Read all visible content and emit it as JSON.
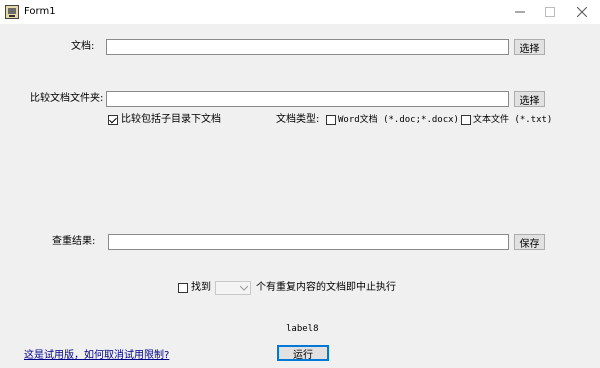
{
  "window": {
    "title": "Form1",
    "icon": "app-icon",
    "controls": [
      "minimize-icon",
      "maximize-icon",
      "close-icon"
    ]
  },
  "document": {
    "label": "文档:",
    "value": "",
    "browse_label": "选择"
  },
  "compare_folder": {
    "label": "比较文档文件夹:",
    "value": "",
    "browse_label": "选择",
    "include_subdirs": {
      "label": "比较包括子目录下文档",
      "checked": true
    }
  },
  "doc_type": {
    "label": "文档类型:",
    "word": {
      "label": "Word文档 (*.doc;*.docx)",
      "checked": false
    },
    "text": {
      "label": "文本文件 (*.txt)",
      "checked": false
    }
  },
  "result": {
    "label": "查重结果:",
    "value": "",
    "save_label": "保存"
  },
  "stop_option": {
    "checkbox_label": "找到",
    "count_value": "",
    "suffix": "个有重复内容的文档即中止执行",
    "checked": false
  },
  "status_label": "label8",
  "trial_link": "这是试用版，如何取消试用限制?",
  "run_label": "运行"
}
